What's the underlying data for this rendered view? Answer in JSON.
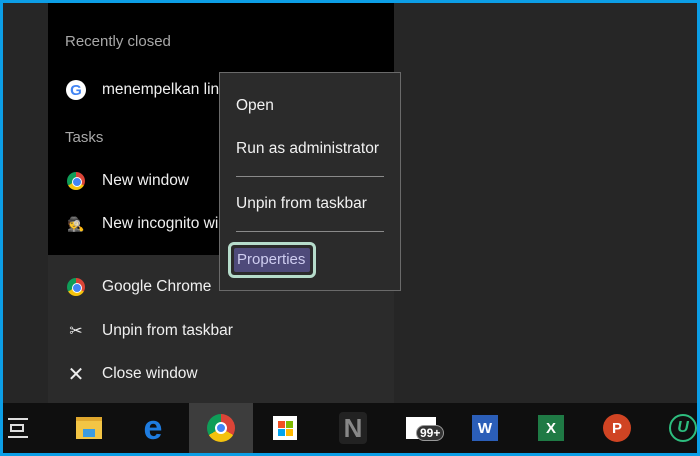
{
  "jump_list": {
    "recently_closed_header": "Recently closed",
    "recent_item": "menempelkan link",
    "tasks_header": "Tasks",
    "tasks": [
      "New window",
      "New incognito window"
    ],
    "app_name": "Google Chrome",
    "unpin": "Unpin from taskbar",
    "close": "Close window"
  },
  "context_menu": {
    "items": [
      "Open",
      "Run as administrator",
      "Unpin from taskbar",
      "Properties"
    ],
    "highlighted": "Properties"
  },
  "taskbar": {
    "icons": [
      "task-view",
      "file-explorer",
      "edge",
      "chrome",
      "store",
      "n-app",
      "mail",
      "word",
      "excel",
      "powerpoint",
      "u-app"
    ],
    "active": "chrome",
    "mail_badge": "99+",
    "word_letter": "W",
    "excel_letter": "X",
    "powerpoint_letter": "P",
    "u_letter": "U",
    "n_letter": "N"
  },
  "colors": {
    "border": "#0c9ee6",
    "highlight_border": "#b6dccb",
    "highlight_fill": "#4e4a7a"
  }
}
